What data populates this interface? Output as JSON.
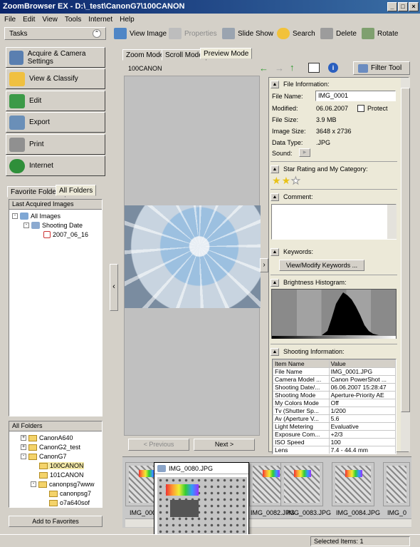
{
  "window": {
    "title": "ZoomBrowser EX - D:\\_test\\CanonG7\\100CANON",
    "min": "_",
    "max": "□",
    "close": "×"
  },
  "menu": [
    "File",
    "Edit",
    "View",
    "Tools",
    "Internet",
    "Help"
  ],
  "tasks": {
    "header": "Tasks",
    "buttons": [
      "Acquire & Camera Settings",
      "View & Classify",
      "Edit",
      "Export",
      "Print",
      "Internet"
    ]
  },
  "toolbar": {
    "view_image": "View Image",
    "properties": "Properties",
    "slide_show": "Slide Show",
    "search": "Search",
    "delete": "Delete",
    "rotate": "Rotate"
  },
  "mode_tabs": [
    "Zoom Mode",
    "Scroll Mode",
    "Preview Mode"
  ],
  "folder_label": "100CANON",
  "filter_tool": "Filter Tool",
  "left_tabs": [
    "Favorite Folders",
    "All Folders"
  ],
  "last_acquired": {
    "header": "Last Acquired Images",
    "items": [
      "All Images",
      "Shooting Date",
      "2007_06_16"
    ]
  },
  "all_folders": {
    "header": "All Folders",
    "items": [
      "CanonA640",
      "CanonG2_test",
      "CanonG7",
      "100CANON",
      "101CANON",
      "canonpsg7www",
      "canonpsg7",
      "o7a640sof"
    ]
  },
  "add_favorites": "Add to Favorites",
  "nav": {
    "previous": "< Previous",
    "next": "Next >"
  },
  "file_info": {
    "header": "File Information:",
    "name_label": "File Name:",
    "name_value": "IMG_0001",
    "modified_label": "Modified:",
    "modified_value": "06.06.2007",
    "protect": "Protect",
    "size_label": "File Size:",
    "size_value": "3.9 MB",
    "imgsize_label": "Image Size:",
    "imgsize_value": "3648 x 2736",
    "type_label": "Data Type:",
    "type_value": ".JPG",
    "sound_label": "Sound:"
  },
  "rating": {
    "header": "Star Rating and My Category:",
    "stars": 2,
    "max": 3
  },
  "comment": {
    "header": "Comment:"
  },
  "keywords": {
    "header": "Keywords:",
    "button": "View/Modify Keywords ..."
  },
  "histogram": {
    "header": "Brightness Histogram:"
  },
  "shooting": {
    "header": "Shooting Information:",
    "columns": [
      "Item Name",
      "Value"
    ],
    "rows": [
      [
        "File Name",
        "IMG_0001.JPG"
      ],
      [
        "Camera Model ...",
        "Canon PowerShot ..."
      ],
      [
        "Shooting Date/...",
        "06.06.2007 15:28:47"
      ],
      [
        "Shooting Mode",
        "Aperture-Priority AE"
      ],
      [
        "My Colors Mode",
        "Off"
      ],
      [
        "Tv (Shutter Sp...",
        "1/200"
      ],
      [
        "Av (Aperture V...",
        "5.6"
      ],
      [
        "Light Metering",
        "Evaluative"
      ],
      [
        "Exposure Com...",
        "+2/3"
      ],
      [
        "ISO Speed",
        "100"
      ],
      [
        "Lens",
        "7.4 - 44.4 mm"
      ]
    ]
  },
  "thumbnails": [
    "IMG_000",
    "IMG_0082.JPG",
    "IMG_0083.JPG",
    "IMG_0084.JPG",
    "IMG_0"
  ],
  "tooltip": {
    "title": "IMG_0080.JPG"
  },
  "status": {
    "selected": "Selected Items: 1"
  }
}
